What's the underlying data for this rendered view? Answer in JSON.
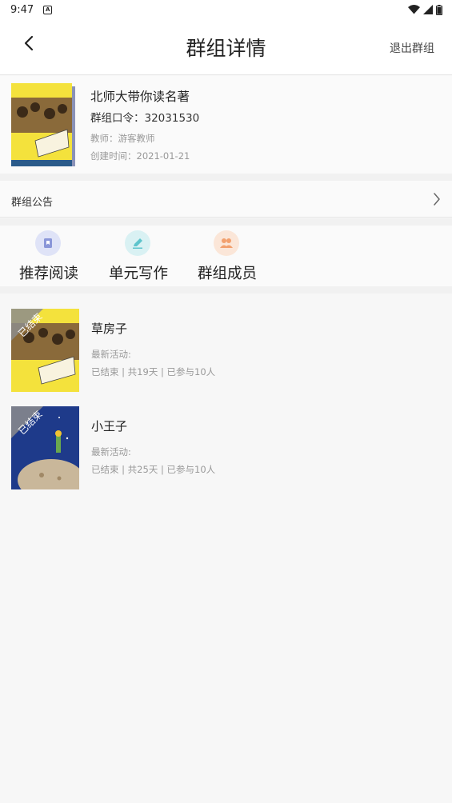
{
  "status_bar": {
    "time": "9:47"
  },
  "header": {
    "title": "群组详情",
    "exit_label": "退出群组"
  },
  "group": {
    "name": "北师大带你读名著",
    "code": "群组口令：32031530",
    "teacher": "教师：游客教师",
    "created": "创建时间：2021-01-21"
  },
  "announcement": {
    "label": "群组公告"
  },
  "tiles": [
    {
      "label": "推荐阅读",
      "icon": "bookmark-icon",
      "color": "#dfe3f7"
    },
    {
      "label": "单元写作",
      "icon": "edit-icon",
      "color": "#d9f1f3"
    },
    {
      "label": "群组成员",
      "icon": "members-icon",
      "color": "#fbe6d8"
    }
  ],
  "books": [
    {
      "title": "草房子",
      "activity_label": "最新活动:",
      "meta": "已结束 | 共19天 | 已参与10人",
      "badge": "已结束"
    },
    {
      "title": "小王子",
      "activity_label": "最新活动:",
      "meta": "已结束 | 共25天 | 已参与10人",
      "badge": "已结束"
    }
  ]
}
